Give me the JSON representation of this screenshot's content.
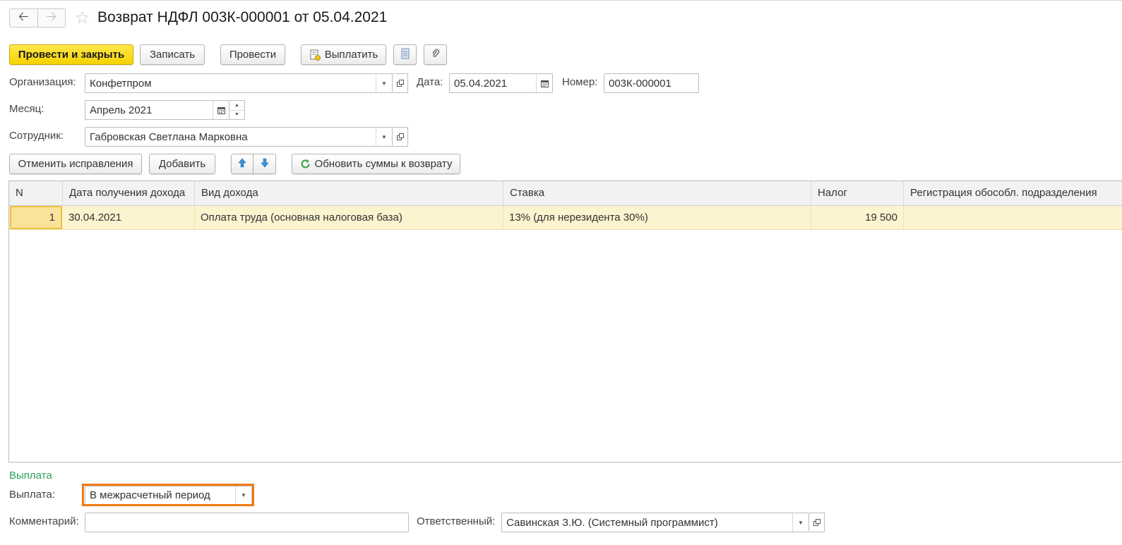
{
  "header": {
    "title": "Возврат НДФЛ 003К-000001 от 05.04.2021"
  },
  "toolbar": {
    "post_close_label": "Провести и закрыть",
    "save_label": "Записать",
    "post_label": "Провести",
    "pay_label": "Выплатить"
  },
  "form": {
    "org_label": "Организация:",
    "org_value": "Конфетпром",
    "date_label": "Дата:",
    "date_value": "05.04.2021",
    "number_label": "Номер:",
    "number_value": "003К-000001",
    "month_label": "Месяц:",
    "month_value": "Апрель 2021",
    "employee_label": "Сотрудник:",
    "employee_value": "Габровская Светлана Марковна"
  },
  "table_toolbar": {
    "cancel_label": "Отменить исправления",
    "add_label": "Добавить",
    "refresh_label": "Обновить суммы к возврату"
  },
  "table": {
    "columns": [
      "N",
      "Дата получения дохода",
      "Вид дохода",
      "Ставка",
      "Налог",
      "Регистрация обособл. подразделения"
    ],
    "rows": [
      [
        "1",
        "30.04.2021",
        "Оплата труда (основная налоговая база)",
        "13% (для нерезидента 30%)",
        "19 500",
        ""
      ]
    ]
  },
  "payment": {
    "section_title": "Выплата",
    "payout_label": "Выплата:",
    "payout_value": "В межрасчетный период",
    "comment_label": "Комментарий:",
    "comment_value": "",
    "responsible_label": "Ответственный:",
    "responsible_value": "Савинская З.Ю. (Системный программист)"
  },
  "colors": {
    "primary_button": "#f5d200",
    "selected_row": "#fcf3cf",
    "section_title": "#2ea05a",
    "highlight_border": "#f07a10"
  }
}
